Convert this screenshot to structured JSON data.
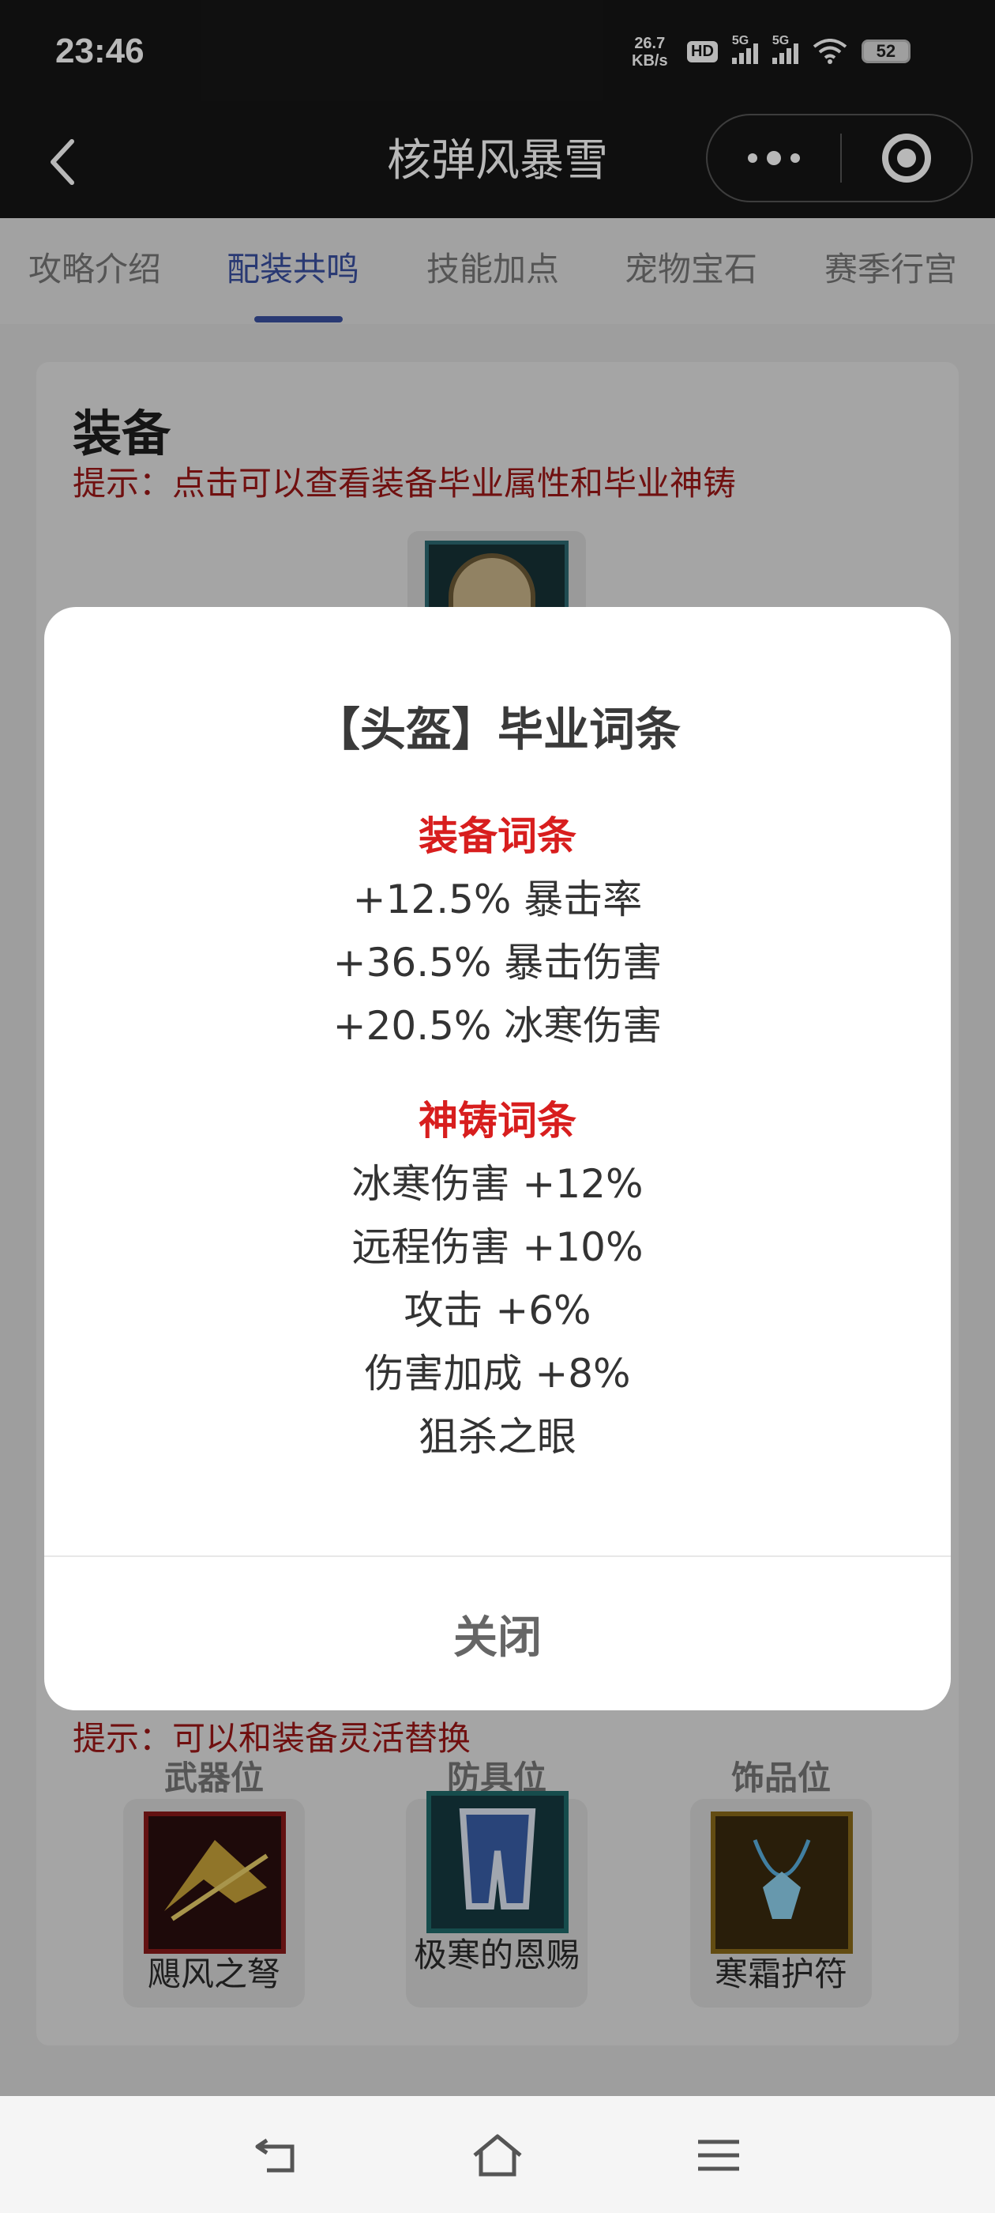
{
  "status_bar": {
    "time": "23:46",
    "net_speed_value": "26.7",
    "net_speed_unit": "KB/s",
    "hd_label": "HD",
    "signal_1_label": "5G",
    "signal_2_label": "5G",
    "battery": "52"
  },
  "header": {
    "title": "核弹风暴雪"
  },
  "tabs": [
    "攻略介绍",
    "配装共鸣",
    "技能加点",
    "宠物宝石",
    "赛季行宫"
  ],
  "active_tab": "配装共鸣",
  "equipment": {
    "title": "装备",
    "hint": "提示：点击可以查看装备毕业属性和毕业神铸"
  },
  "resonance": {
    "hint": "提示：可以和装备灵活替换",
    "slots": [
      {
        "header": "武器位",
        "name": "飓风之弩",
        "color": "#8a1a1a"
      },
      {
        "header": "防具位",
        "name": "极寒的恩赐",
        "color": "#1f6a6a"
      },
      {
        "header": "饰品位",
        "name": "寒霜护符",
        "color": "#8a6a1a"
      }
    ]
  },
  "modal": {
    "title": "【头盔】毕业词条",
    "equip_section_title": "装备词条",
    "equip_attrs": [
      "+12.5% 暴击率",
      "+36.5% 暴击伤害",
      "+20.5% 冰寒伤害"
    ],
    "forge_section_title": "神铸词条",
    "forge_attrs": [
      "冰寒伤害 +12%",
      "远程伤害 +10%",
      "攻击 +6%",
      "伤害加成 +8%",
      "狙杀之眼"
    ],
    "close_label": "关闭"
  },
  "colors": {
    "accent": "#3a4fa0",
    "hint_red": "#9b1717",
    "section_red": "#d81e1e"
  }
}
